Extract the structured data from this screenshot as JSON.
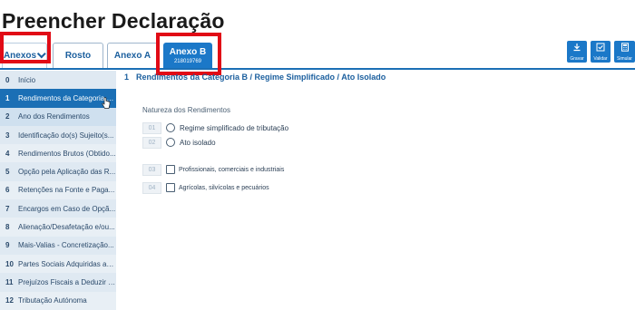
{
  "page": {
    "title": "Preencher Declaração"
  },
  "tabs": {
    "anexos": "Anexos",
    "rosto": "Rosto",
    "anexo_a": "Anexo A",
    "anexo_b": {
      "label": "Anexo B",
      "sub": "218019769"
    }
  },
  "toolbar": {
    "gravar": "Gravar",
    "validar": "Validar",
    "simular": "Simular"
  },
  "sidebar": {
    "items": [
      {
        "num": "0",
        "label": "Início"
      },
      {
        "num": "1",
        "label": "Rendimentos da Categoria B..."
      },
      {
        "num": "2",
        "label": "Ano dos Rendimentos"
      },
      {
        "num": "3",
        "label": "Identificação do(s) Sujeito(s..."
      },
      {
        "num": "4",
        "label": "Rendimentos Brutos (Obtido..."
      },
      {
        "num": "5",
        "label": "Opção pela Aplicação das R..."
      },
      {
        "num": "6",
        "label": "Retenções na Fonte e Paga..."
      },
      {
        "num": "7",
        "label": "Encargos em Caso de Opçã..."
      },
      {
        "num": "8",
        "label": "Alienação/Desafetação e/ou..."
      },
      {
        "num": "9",
        "label": "Mais-Valias - Concretização..."
      },
      {
        "num": "10",
        "label": "Partes Sociais Adquiridas ao..."
      },
      {
        "num": "11",
        "label": "Prejuízos Fiscais a Deduzir e..."
      },
      {
        "num": "12",
        "label": "Tributação Autónoma"
      }
    ]
  },
  "section": {
    "num": "1",
    "title": "Rendimentos da Categoria B / Regime Simplificado / Ato Isolado",
    "natureza_label": "Natureza dos Rendimentos",
    "options": [
      {
        "code": "01",
        "label": "Regime simplificado de tributação"
      },
      {
        "code": "02",
        "label": "Ato isolado"
      }
    ],
    "activities": [
      {
        "code": "03",
        "label": "Profissionais, comerciais e industriais"
      },
      {
        "code": "04",
        "label": "Agrícolas, silvícolas e pecuários"
      }
    ]
  },
  "colors": {
    "accent": "#1b78c8",
    "highlight": "#e10b16",
    "sidebar": "#dfe9f2"
  }
}
